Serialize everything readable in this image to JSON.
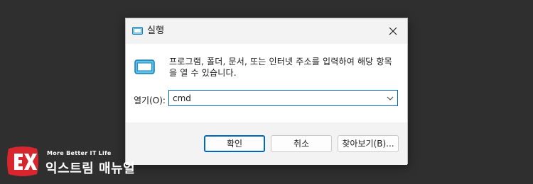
{
  "window": {
    "title": "실행",
    "close_icon": "close-icon"
  },
  "body": {
    "description": "프로그램, 폴더, 문서, 또는 인터넷 주소를 입력하여 해당 항목을 열 수 있습니다.",
    "open_label": "열기(O):",
    "open_value": "cmd"
  },
  "buttons": {
    "ok": "확인",
    "cancel": "취소",
    "browse": "찾아보기(B)..."
  },
  "watermark": {
    "tagline": "More Better IT Life",
    "name": "익스트림 매뉴얼"
  },
  "colors": {
    "accent": "#0067c0",
    "background": "#2f2f2f",
    "logo_red": "#d8262e"
  }
}
